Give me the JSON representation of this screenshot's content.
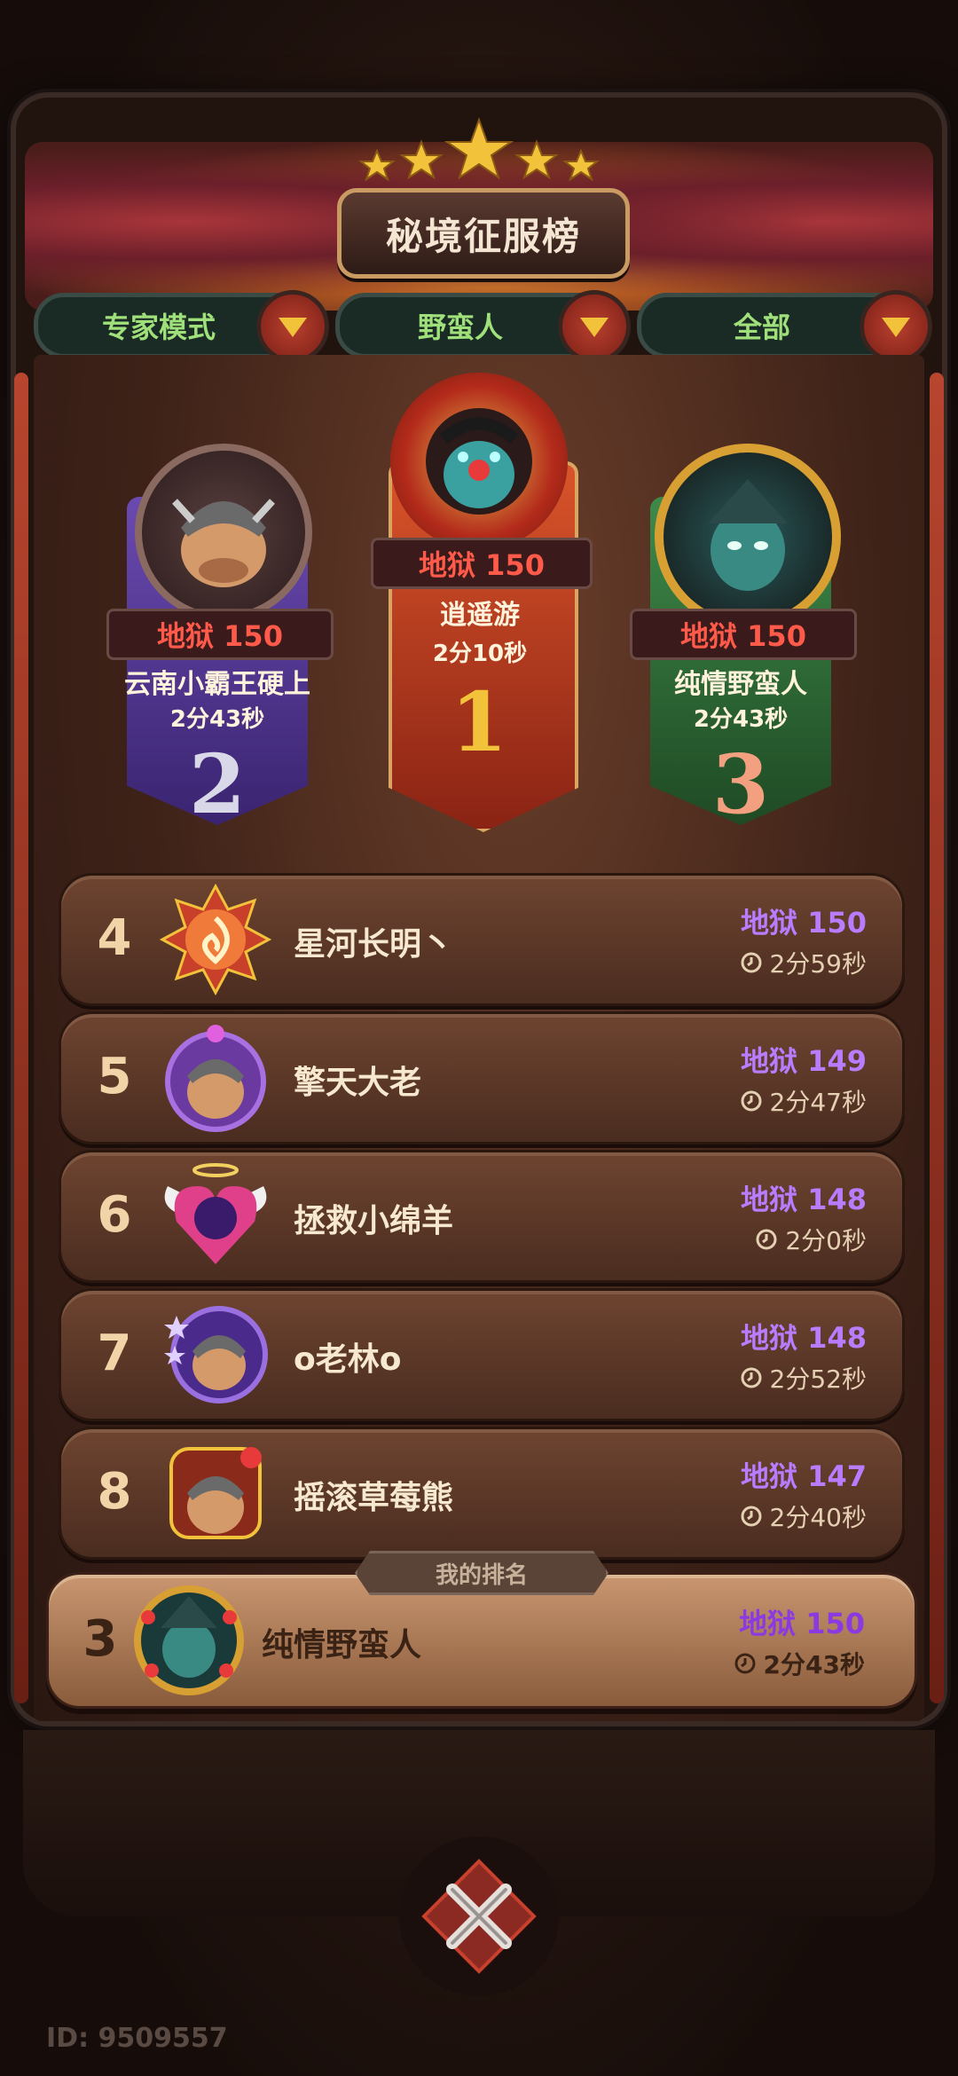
{
  "header": {
    "title": "秘境征服榜"
  },
  "filters": [
    {
      "label": "专家模式"
    },
    {
      "label": "野蛮人"
    },
    {
      "label": "全部"
    }
  ],
  "podium": [
    {
      "rank": "1",
      "level": "地狱 150",
      "name": "逍遥游",
      "time": "2分10秒"
    },
    {
      "rank": "2",
      "level": "地狱 150",
      "name": "云南小霸王硬上",
      "time": "2分43秒"
    },
    {
      "rank": "3",
      "level": "地狱 150",
      "name": "纯情野蛮人",
      "time": "2分43秒"
    }
  ],
  "list": [
    {
      "rank": "4",
      "name": "星河长明丶",
      "level": "地狱 150",
      "time": "2分59秒"
    },
    {
      "rank": "5",
      "name": "擎天大老",
      "level": "地狱 149",
      "time": "2分47秒"
    },
    {
      "rank": "6",
      "name": "拯救小绵羊",
      "level": "地狱 148",
      "time": "2分0秒"
    },
    {
      "rank": "7",
      "name": "o老林o",
      "level": "地狱 148",
      "time": "2分52秒"
    },
    {
      "rank": "8",
      "name": "摇滚草莓熊",
      "level": "地狱 147",
      "time": "2分40秒"
    }
  ],
  "my_rank": {
    "label": "我的排名",
    "rank": "3",
    "name": "纯情野蛮人",
    "level": "地狱 150",
    "time": "2分43秒"
  },
  "footer": {
    "id_text": "ID: 9509557"
  },
  "colors": {
    "level_purple": "#b87cff",
    "level_red": "#ff5a4a",
    "filter_green": "#9fe07a",
    "gold": "#f2c23a"
  }
}
